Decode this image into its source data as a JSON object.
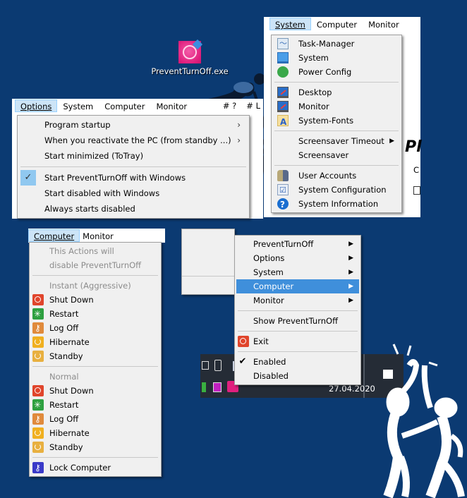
{
  "desktop": {
    "icon_label": "PreventTurnOff.exe",
    "icon_name": "preventturnoff-app-icon"
  },
  "system_window": {
    "menubar": [
      {
        "label": "System",
        "accel": "S",
        "active": true
      },
      {
        "label": "Computer",
        "accel": "C",
        "active": false
      },
      {
        "label": "Monitor",
        "accel": "M",
        "active": false
      }
    ],
    "menu": {
      "items": [
        {
          "label": "Task-Manager",
          "icon": "task-manager-icon"
        },
        {
          "label": "System",
          "icon": "monitor-icon"
        },
        {
          "label": "Power Config",
          "icon": "power-plug-icon"
        },
        {
          "label": "Desktop",
          "icon": "desktop-icon"
        },
        {
          "label": "Monitor",
          "icon": "desktop-icon"
        },
        {
          "label": "System-Fonts",
          "icon": "fonts-icon"
        },
        {
          "label": "Screensaver Timeout",
          "submenu": true
        },
        {
          "label": "Screensaver"
        },
        {
          "label": "User Accounts",
          "icon": "users-icon"
        },
        {
          "label": "System Configuration",
          "icon": "system-config-icon"
        },
        {
          "label": "System Information",
          "icon": "help-icon"
        }
      ]
    },
    "background_fragments": [
      "Pl",
      "C"
    ]
  },
  "options_window": {
    "menubar": [
      {
        "label": "Options",
        "accel": "O",
        "active": true
      },
      {
        "label": "System",
        "accel": "S",
        "active": false
      },
      {
        "label": "Computer",
        "accel": "C",
        "active": false
      },
      {
        "label": "Monitor",
        "accel": "M",
        "active": false
      }
    ],
    "menubar_right": [
      "# ?",
      "# L"
    ],
    "menu": {
      "items": [
        {
          "label": "Program startup",
          "submenu": true
        },
        {
          "label": "When you reactivate the PC (from standby ...)",
          "submenu": true
        },
        {
          "label": "Start minimized (ToTray)"
        },
        {
          "label": "Start PreventTurnOff with Windows",
          "checked": true
        },
        {
          "label": "Start disabled with Windows"
        },
        {
          "label": "Always starts disabled"
        }
      ]
    }
  },
  "computer_window": {
    "menubar": [
      {
        "label": "Computer",
        "accel": "C",
        "active": true
      },
      {
        "label": "Monitor",
        "accel": "M",
        "active": false
      }
    ],
    "menu": {
      "header_lines": [
        "This Actions will",
        "disable PreventTurnOff"
      ],
      "instant_label": "Instant (Aggressive)",
      "instant_items": [
        {
          "label": "Shut Down",
          "icon": "shutdown-icon"
        },
        {
          "label": "Restart",
          "icon": "restart-icon"
        },
        {
          "label": "Log Off",
          "icon": "logoff-key-icon"
        },
        {
          "label": "Hibernate",
          "icon": "hibernate-icon"
        },
        {
          "label": "Standby",
          "icon": "standby-icon"
        }
      ],
      "normal_label": "Normal",
      "normal_items": [
        {
          "label": "Shut Down",
          "icon": "shutdown-icon"
        },
        {
          "label": "Restart",
          "icon": "restart-icon"
        },
        {
          "label": "Log Off",
          "icon": "logoff-key-icon"
        },
        {
          "label": "Hibernate",
          "icon": "hibernate-icon"
        },
        {
          "label": "Standby",
          "icon": "standby-icon"
        }
      ],
      "lock_item": {
        "label": "Lock Computer",
        "icon": "lock-key-icon"
      }
    }
  },
  "tray_menu": {
    "items": [
      {
        "label": "PreventTurnOff",
        "submenu": true
      },
      {
        "label": "Options",
        "submenu": true
      },
      {
        "label": "System",
        "submenu": true
      },
      {
        "label": "Computer",
        "submenu": true,
        "highlighted": true
      },
      {
        "label": "Monitor",
        "submenu": true
      }
    ],
    "show_label": "Show PreventTurnOff",
    "exit_label": "Exit",
    "enabled_label": "Enabled",
    "enabled_checked": true,
    "disabled_label": "Disabled"
  },
  "taskbar": {
    "date": "27.04.2020"
  },
  "colors": {
    "desktop_bg": "#0b3a72",
    "menu_bg": "#f0f0f0",
    "highlight": "#3f8fdb",
    "menubar_active": "#cce4f7",
    "taskbar": "#252c36"
  }
}
